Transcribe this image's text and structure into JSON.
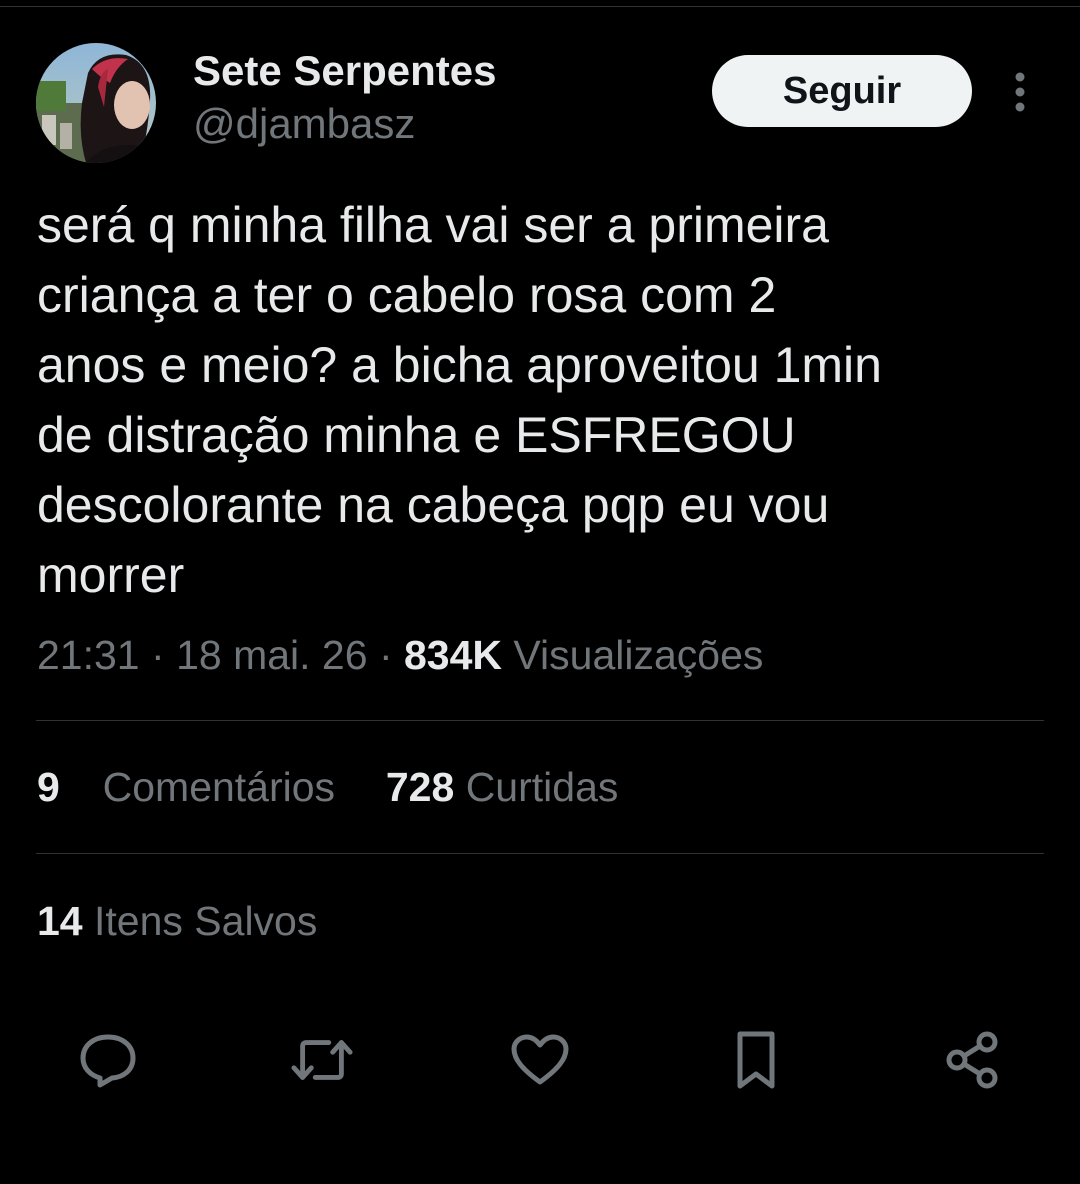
{
  "user": {
    "display_name": "Sete Serpentes",
    "handle": "@djambasz",
    "follow_label": "Seguir"
  },
  "tweet": {
    "lines": [
      "será q minha filha vai ser a primeira",
      "criança a ter o cabelo rosa com 2",
      "anos e meio? a bicha aproveitou 1min",
      "de distração minha e ESFREGOU",
      "descolorante na cabeça pqp eu vou",
      "morrer"
    ],
    "time": "21:31",
    "date": "18 mai. 26",
    "separator": "·",
    "views_count": "834K",
    "views_label": "Visualizações"
  },
  "stats": {
    "comments_count": "9",
    "comments_label": "Comentários",
    "likes_count": "728",
    "likes_label": "Curtidas",
    "saves_count": "14",
    "saves_label": "Itens Salvos"
  },
  "icons": {
    "more": "more-vertical-icon",
    "reply": "reply-icon",
    "retweet": "retweet-icon",
    "like": "heart-icon",
    "bookmark": "bookmark-icon",
    "share": "share-icon"
  },
  "colors": {
    "background": "#000000",
    "primary_text": "#e7e9ea",
    "secondary_text": "#71767b",
    "divider": "#2f3336",
    "button_bg": "#eff3f4",
    "button_text": "#0f1419"
  }
}
